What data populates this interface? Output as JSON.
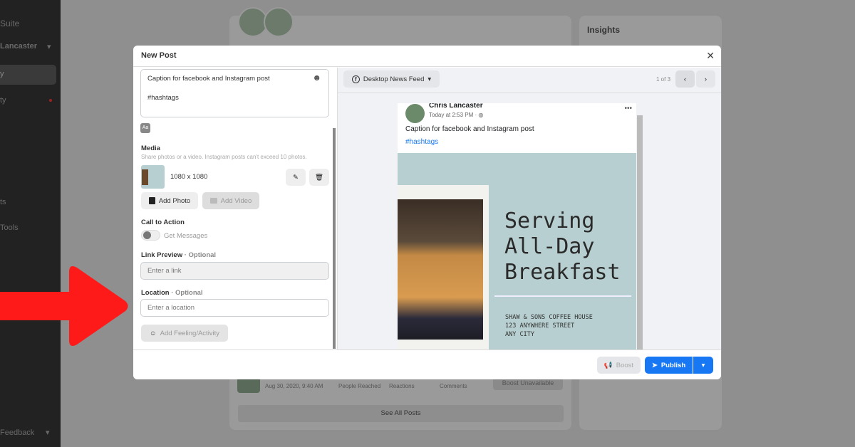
{
  "sidebar": {
    "brand": "Suite",
    "account": "Lancaster",
    "items": [
      "y",
      "ty",
      "ts",
      "Tools"
    ],
    "feedback": "Feedback"
  },
  "background": {
    "insights_title": "Insights",
    "post_date": "Aug 30, 2020, 9:40 AM",
    "people_reached": "People Reached",
    "reactions": "Reactions",
    "comments": "Comments",
    "boost_unavailable": "Boost Unavailable",
    "see_all_posts": "See All Posts"
  },
  "modal": {
    "title": "New Post",
    "caption": {
      "line1": "Caption for facebook and Instagram post",
      "line2": "#hashtags"
    },
    "media": {
      "title": "Media",
      "hint": "Share photos or a video. Instagram posts can't exceed 10 photos.",
      "dimensions": "1080 x 1080",
      "add_photo": "Add Photo",
      "add_video": "Add Video"
    },
    "cta": {
      "title": "Call to Action",
      "toggle_label": "Get Messages",
      "toggle_on": false
    },
    "link": {
      "title": "Link Preview",
      "optional": " · Optional",
      "placeholder": "Enter a link"
    },
    "location": {
      "title": "Location",
      "optional": " · Optional",
      "placeholder": "Enter a location"
    },
    "feeling": "Add Feeling/Activity",
    "preview": {
      "placement": "Desktop News Feed",
      "pager": "1 of 3",
      "author": "Chris Lancaster",
      "time": "Today at 2:53 PM · ",
      "caption": "Caption for facebook and Instagram post",
      "hashtags": "#hashtags",
      "image": {
        "headline": [
          "Serving",
          "All-Day",
          "Breakfast"
        ],
        "address": [
          "SHAW & SONS COFFEE HOUSE",
          "123 ANYWHERE STREET",
          "ANY CITY"
        ]
      }
    },
    "boost": "Boost",
    "publish": "Publish"
  },
  "colors": {
    "accent": "#1877f2",
    "arrow": "#ff1a1a",
    "image_bg": "#b7cfd0"
  }
}
